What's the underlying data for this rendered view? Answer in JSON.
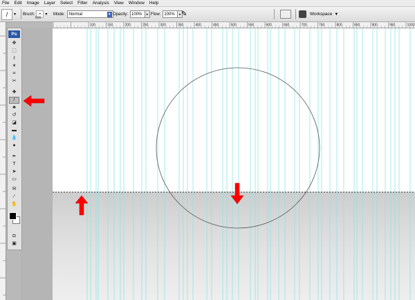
{
  "menu": [
    "File",
    "Edit",
    "Image",
    "Layer",
    "Select",
    "Filter",
    "Analysis",
    "View",
    "Window",
    "Help"
  ],
  "options": {
    "tool_icon": "brush-icon",
    "brush_label": "Brush:",
    "brush_size": "600",
    "mode_label": "Mode:",
    "mode_value": "Normal",
    "opacity_label": "Opacity:",
    "opacity_value": "100%",
    "flow_label": "Flow:",
    "flow_value": "100%",
    "workspace_label": "Workspace"
  },
  "ruler": {
    "top_labels": [
      "100",
      "150",
      "200",
      "250",
      "300",
      "350",
      "400",
      "450",
      "500",
      "550",
      "600",
      "650",
      "700",
      "750",
      "800",
      "850",
      "900",
      "950",
      "1000"
    ]
  },
  "toolbox": {
    "logo": "Ps",
    "tools": [
      "move-tool",
      "marquee-tool",
      "lasso-tool",
      "magic-wand-tool",
      "crop-tool",
      "slice-tool",
      "spot-healing-tool",
      "brush-tool",
      "clone-stamp-tool",
      "history-brush-tool",
      "eraser-tool",
      "gradient-tool",
      "blur-tool",
      "dodge-tool",
      "pen-tool",
      "type-tool",
      "path-selection-tool",
      "shape-tool",
      "notes-tool",
      "eyedropper-tool",
      "hand-tool",
      "zoom-tool"
    ],
    "active_tool": "brush-tool"
  },
  "colors": {
    "guide": "#8fe3e3",
    "arrow": "#ff0000",
    "selection": "#333333"
  }
}
